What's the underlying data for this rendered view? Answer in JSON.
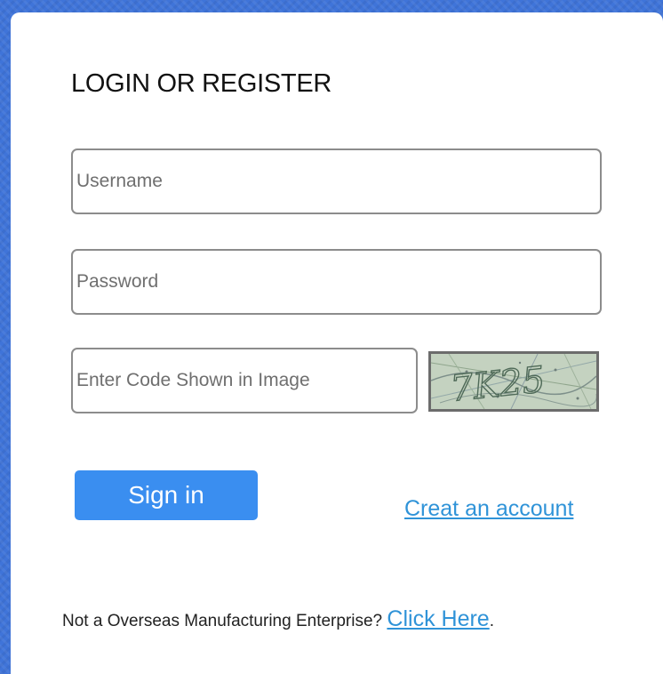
{
  "login_form": {
    "title": "LOGIN OR REGISTER",
    "username_placeholder": "Username",
    "password_placeholder": "Password",
    "code_placeholder": "Enter Code Shown in Image",
    "captcha_text": "7K25",
    "signin_label": "Sign in",
    "create_account_label": "Creat an account"
  },
  "footer": {
    "prompt_text": "Not a Overseas Manufacturing Enterprise?",
    "link_label": "Click Here",
    "trailing_text": "."
  },
  "colors": {
    "page_background": "#3f74d9",
    "card_background": "#ffffff",
    "primary_button": "#3a8ef0",
    "link": "#2f93d8",
    "field_border": "#8c8c8c"
  },
  "icons": {
    "captcha": "captcha-image"
  }
}
